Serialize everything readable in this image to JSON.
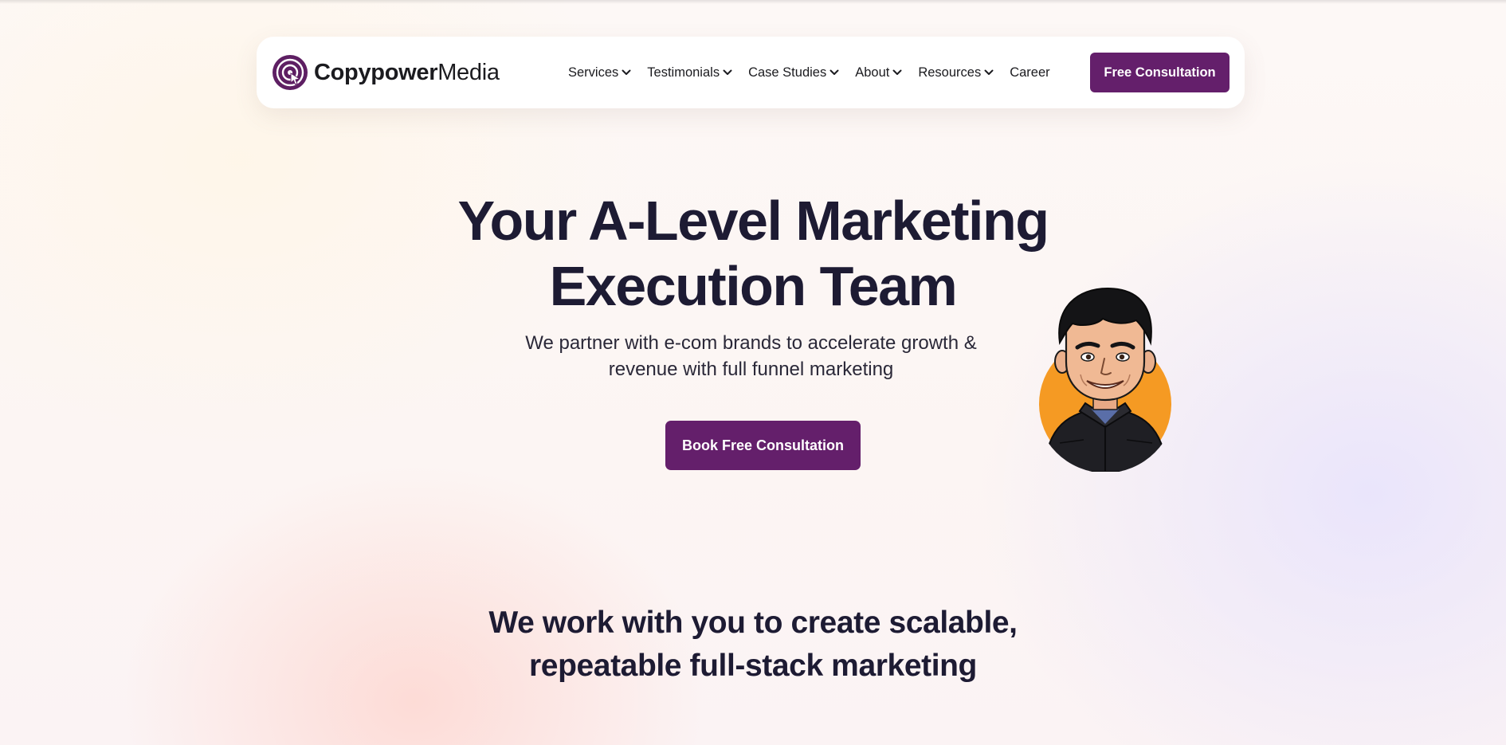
{
  "header": {
    "brand": {
      "name_strong": "Copypower",
      "name_light": "Media",
      "logo_icon": "target-cursor-icon"
    },
    "nav": [
      {
        "label": "Services",
        "has_dropdown": true
      },
      {
        "label": "Testimonials",
        "has_dropdown": true
      },
      {
        "label": "Case Studies",
        "has_dropdown": true
      },
      {
        "label": "About",
        "has_dropdown": true
      },
      {
        "label": "Resources",
        "has_dropdown": true
      },
      {
        "label": "Career",
        "has_dropdown": false
      }
    ],
    "cta_label": "Free Consultation"
  },
  "hero": {
    "title_line1": "Your A-Level Marketing",
    "title_line2": "Execution Team",
    "subtitle_line1": "We partner with e-com brands to accelerate growth &",
    "subtitle_line2": "revenue with full funnel marketing",
    "cta_label": "Book Free Consultation",
    "avatar_icon": "founder-caricature-avatar"
  },
  "section": {
    "title_line1": "We work with you to create scalable,",
    "title_line2": "repeatable full-stack marketing"
  },
  "colors": {
    "brand_purple": "#641f6b",
    "heading": "#1d1b33",
    "avatar_bg": "#f59a23"
  }
}
